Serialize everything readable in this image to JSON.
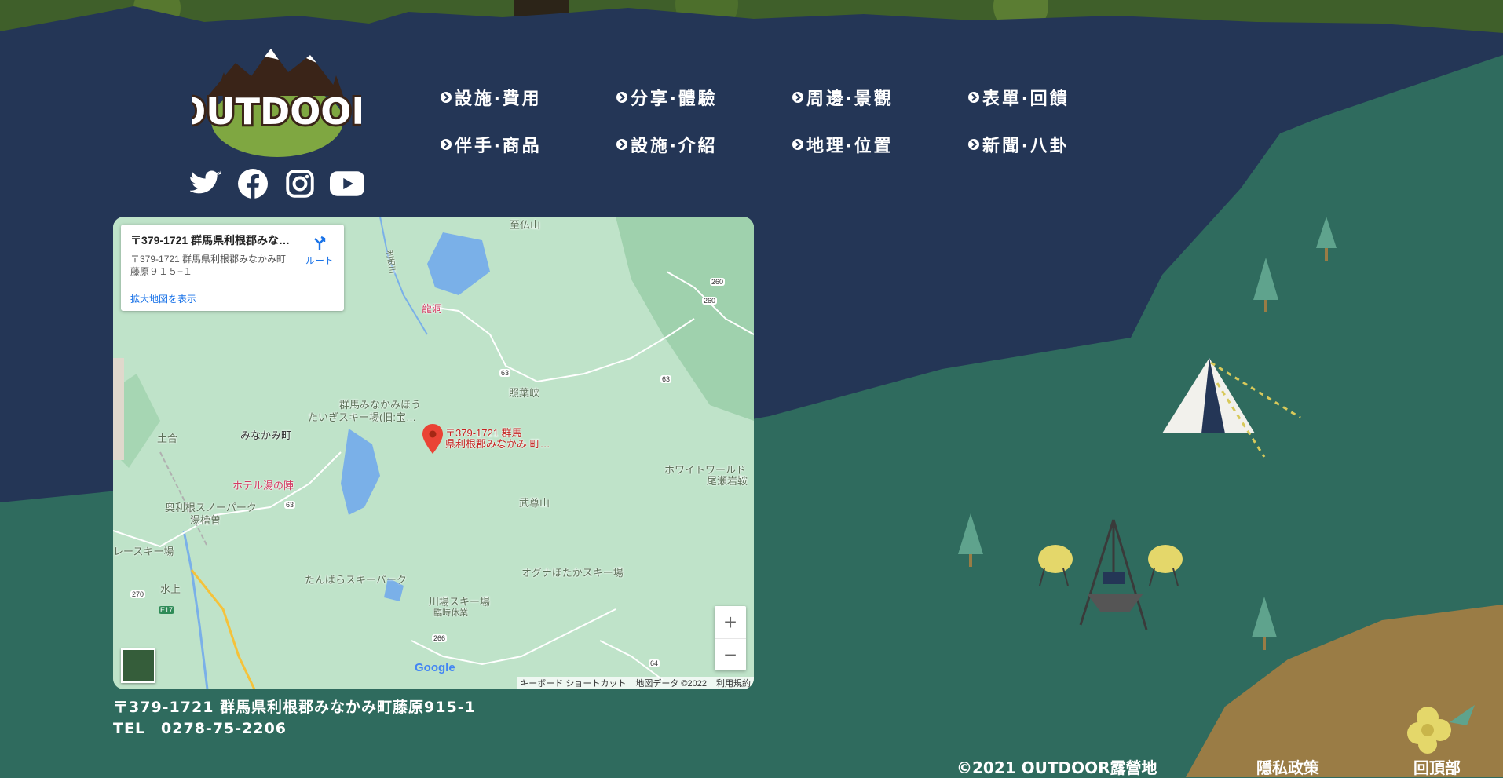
{
  "brand": {
    "logo_text": "OUTDOOR"
  },
  "nav": {
    "items": [
      {
        "label": "設施‧費用"
      },
      {
        "label": "分享‧體驗"
      },
      {
        "label": "周邊‧景觀"
      },
      {
        "label": "表單‧回饋"
      },
      {
        "label": "伴手‧商品"
      },
      {
        "label": "設施‧介紹"
      },
      {
        "label": "地理‧位置"
      },
      {
        "label": "新聞‧八卦"
      }
    ]
  },
  "social": [
    "twitter-icon",
    "facebook-icon",
    "instagram-icon",
    "youtube-icon"
  ],
  "map": {
    "card_title": "〒379-1721 群馬県利根郡みな…",
    "card_address_line1": "〒379-1721 群馬県利根郡みなかみ町",
    "card_address_line2": "藤原９１５−１",
    "card_link": "拡大地図を表示",
    "route_label": "ルート",
    "google_logo": "Google",
    "attribution": {
      "keyboard": "キーボード ショートカット",
      "data": "地図データ ©2022",
      "terms": "利用規約"
    },
    "zoom_in": "+",
    "zoom_out": "−",
    "pin_label_line1": "〒379-1721 群馬",
    "pin_label_line2": "県利根郡みなかみ 町…",
    "places": {
      "ryudo": "龍洞",
      "shoyokyo": "照葉峡",
      "taiki_1": "群馬みなかみほう",
      "taiki_2": "たいぎスキー場(旧:宝…",
      "minakami": "みなかみ町",
      "doai": "土合",
      "hotel": "ホテル湯の陣",
      "okutone_1": "奥利根スノーパーク",
      "okutone_2": "湯檜曽",
      "ski_race": "レースキー場",
      "mizukami": "水上",
      "tanbara": "たんばらスキーパーク",
      "kawaba_1": "川場スキー場",
      "kawaba_2": "臨時休業",
      "ogna": "オグナほたかスキー場",
      "busonyama": "武尊山",
      "white_1": "ホワイトワールド",
      "white_2": "尾瀬岩鞍",
      "shibutsusan": "至仏山",
      "road_60_1": "260",
      "road_60_2": "260",
      "road_63a": "63",
      "road_63b": "63",
      "road_63c": "63",
      "road_270": "270",
      "road_e17": "E17",
      "road_266": "266",
      "road_64": "64",
      "tonegawa": "利根川"
    }
  },
  "contact": {
    "address": "〒379-1721 群馬県利根郡みなかみ町藤原915-1",
    "tel": "TEL　0278-75-2206"
  },
  "footer": {
    "copyright": "©2021 OUTDOOR露營地",
    "privacy": "隱私政策",
    "top": "回頂部"
  },
  "colors": {
    "navy": "#243656",
    "green": "#2f6b5e",
    "sand": "#9a7c45",
    "tent": "#f2f1ec"
  }
}
